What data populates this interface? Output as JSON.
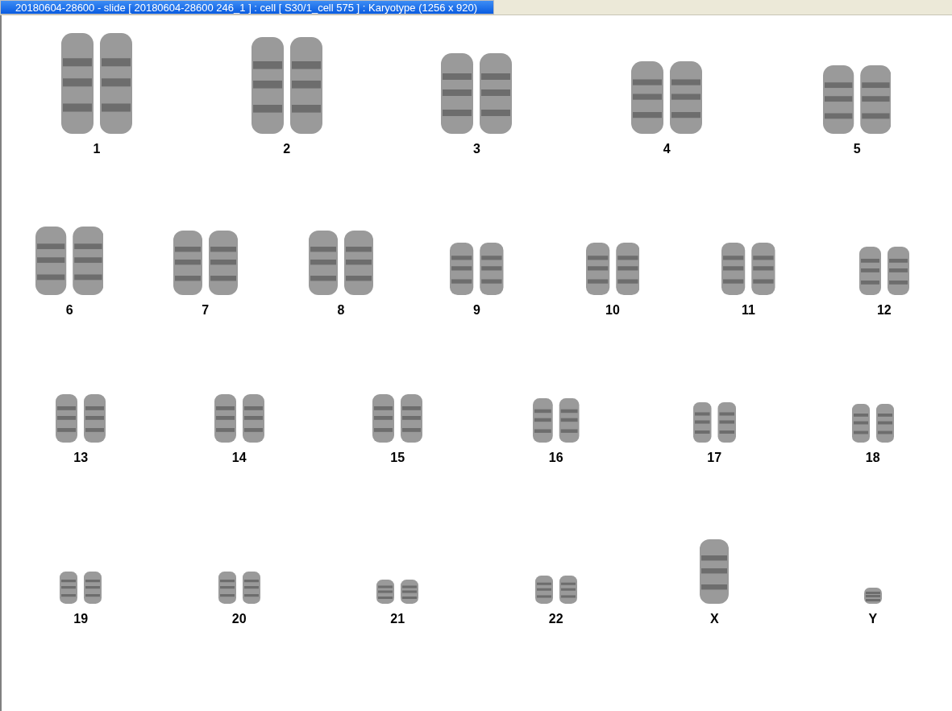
{
  "window": {
    "title": "20180604-28600 - slide [ 20180604-28600 246_1 ] : cell [ S30/1_cell 575 ] : Karyotype  (1256 x 920)"
  },
  "karyotype": {
    "rows": [
      {
        "items": [
          {
            "label": "1",
            "kind": "pair"
          },
          {
            "label": "2",
            "kind": "pair"
          },
          {
            "label": "3",
            "kind": "pair"
          },
          {
            "label": "4",
            "kind": "pair"
          },
          {
            "label": "5",
            "kind": "pair"
          }
        ]
      },
      {
        "items": [
          {
            "label": "6",
            "kind": "pair"
          },
          {
            "label": "7",
            "kind": "pair"
          },
          {
            "label": "8",
            "kind": "pair"
          },
          {
            "label": "9",
            "kind": "pair"
          },
          {
            "label": "10",
            "kind": "pair"
          },
          {
            "label": "11",
            "kind": "pair"
          },
          {
            "label": "12",
            "kind": "pair"
          }
        ]
      },
      {
        "items": [
          {
            "label": "13",
            "kind": "pair"
          },
          {
            "label": "14",
            "kind": "pair"
          },
          {
            "label": "15",
            "kind": "pair"
          },
          {
            "label": "16",
            "kind": "pair"
          },
          {
            "label": "17",
            "kind": "pair"
          },
          {
            "label": "18",
            "kind": "pair"
          }
        ]
      },
      {
        "items": [
          {
            "label": "19",
            "kind": "pair"
          },
          {
            "label": "20",
            "kind": "pair"
          },
          {
            "label": "21",
            "kind": "pair"
          },
          {
            "label": "22",
            "kind": "pair"
          },
          {
            "label": "X",
            "kind": "single"
          },
          {
            "label": "Y",
            "kind": "single"
          }
        ]
      }
    ]
  }
}
